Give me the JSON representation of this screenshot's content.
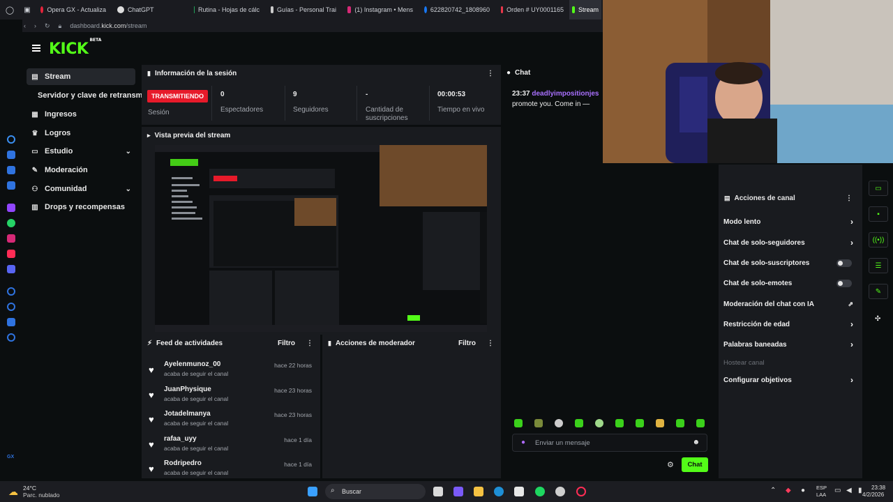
{
  "browser": {
    "tabs": [
      {
        "label": "Opera GX - Actualiza",
        "color": "#e5243b"
      },
      {
        "label": "ChatGPT",
        "color": "#dddddd"
      },
      {
        "label": "Rutina - Hojas de cálc",
        "color": "#22a35a"
      },
      {
        "label": "Guías - Personal Trai",
        "color": "#cccccc"
      },
      {
        "label": "(1) Instagram • Mens",
        "color": "#d62976"
      },
      {
        "label": "622820742_1808960",
        "color": "#1877f2"
      },
      {
        "label": "Orden # UY0001165",
        "color": "#e8374a"
      },
      {
        "label": "Stream",
        "color": "#53fc18"
      }
    ],
    "url_prefix": "dashboard.",
    "url_domain": "kick.com",
    "url_path": "/stream"
  },
  "kick": {
    "logo": "KICK",
    "logo_tag": "BETA",
    "nav": [
      {
        "label": "Stream",
        "icon": "▤",
        "selected": true
      },
      {
        "label": "Servidor y clave de retransmisión",
        "icon": "",
        "selected": false,
        "indent": true
      },
      {
        "label": "Ingresos",
        "icon": "▦",
        "selected": false
      },
      {
        "label": "Logros",
        "icon": "🏆",
        "selected": false
      },
      {
        "label": "Estudio",
        "icon": "▭",
        "selected": false,
        "chevron": true
      },
      {
        "label": "Moderación",
        "icon": "✎",
        "selected": false
      },
      {
        "label": "Comunidad",
        "icon": "👥",
        "selected": false,
        "chevron": true
      },
      {
        "label": "Drops y recompensas",
        "icon": "▥",
        "selected": false
      }
    ],
    "session": {
      "title": "Información de la sesión",
      "live_badge": "TRANSMITIENDO",
      "live_label": "Sesión",
      "stats": [
        {
          "value": "0",
          "label": "Espectadores"
        },
        {
          "value": "9",
          "label": "Seguidores"
        },
        {
          "value": "-",
          "label": "Cantidad de suscripciones"
        },
        {
          "value": "00:00:53",
          "label": "Tiempo en vivo"
        }
      ]
    },
    "preview": {
      "title": "Vista previa del stream"
    },
    "feed": {
      "title": "Feed de actividades",
      "filter": "Filtro",
      "items": [
        {
          "name": "Ayelenmunoz_00",
          "action": "acaba de seguir el canal",
          "time": "hace 22 horas"
        },
        {
          "name": "JuanPhysique",
          "action": "acaba de seguir el canal",
          "time": "hace 23 horas"
        },
        {
          "name": "Jotadelmanya",
          "action": "acaba de seguir el canal",
          "time": "hace 23 horas"
        },
        {
          "name": "rafaa_uyy",
          "action": "acaba de seguir el canal",
          "time": "hace 1 día"
        },
        {
          "name": "Rodripedro",
          "action": "acaba de seguir el canal",
          "time": "hace 1 día"
        }
      ]
    },
    "moderator": {
      "title": "Acciones de moderador",
      "filter": "Filtro"
    },
    "chat": {
      "title": "Chat",
      "messages": [
        {
          "time": "23:37",
          "user": "deadlyimpositionjes",
          "text": "promote you. Come  in —"
        }
      ],
      "placeholder": "Enviar un mensaje",
      "send_label": "Chat"
    },
    "channel_actions": {
      "title": "Acciones de canal",
      "items": [
        {
          "label": "Modo lento",
          "control": "chevron"
        },
        {
          "label": "Chat de solo-seguidores",
          "control": "chevron"
        },
        {
          "label": "Chat de solo-suscriptores",
          "control": "toggle",
          "on": false
        },
        {
          "label": "Chat de solo-emotes",
          "control": "toggle",
          "on": false
        },
        {
          "label": "Moderación del chat con IA",
          "control": "external"
        },
        {
          "label": "Restricción de edad",
          "control": "chevron"
        },
        {
          "label": "Palabras baneadas",
          "control": "chevron"
        },
        {
          "label": "Hostear canal",
          "control": "none",
          "disabled": true
        },
        {
          "label": "Configurar objetivos",
          "control": "chevron"
        }
      ]
    }
  },
  "taskbar": {
    "weather_temp": "24°C",
    "weather_desc": "Parc. nublado",
    "search": "Buscar",
    "lang_top": "ESP",
    "lang_bottom": "LAA",
    "time": "23:38",
    "date": "4/2/2026"
  },
  "colors": {
    "accent": "#53fc18",
    "live": "#e71a2a",
    "username": "#a970ff"
  }
}
